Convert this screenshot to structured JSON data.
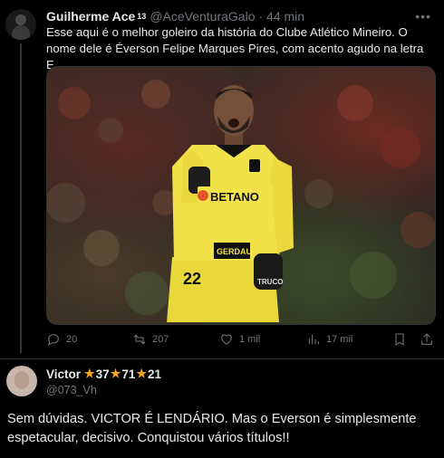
{
  "tweet1": {
    "author": "Guilherme Ace",
    "author_badge": "13",
    "handle": "@AceVenturaGalo",
    "time": "· 44 min",
    "text": "Esse aqui é o melhor goleiro da história do Clube Atlético Mineiro. O nome dele é Éverson Felipe Marques Pires, com acento agudo na letra E.",
    "media": {
      "sponsor_chest": "BETANO",
      "sponsor_belly": "GERDAU",
      "shorts_number": "22",
      "glove_text": "TRUCO"
    },
    "stats": {
      "replies": "20",
      "retweets": "207",
      "likes": "1 mil",
      "views": "17 mil"
    },
    "icons": [
      "reply-icon",
      "retweet-icon",
      "like-icon",
      "views-icon",
      "bookmark-icon",
      "share-icon",
      "more-icon"
    ]
  },
  "tweet2": {
    "author": "Victor",
    "badges": [
      "37",
      "71",
      "21"
    ],
    "handle": "@073_Vh",
    "text": "Sem dúvidas. VICTOR É LENDÁRIO. Mas o Everson é simplesmente espetacular, decisivo. Conquistou vários títulos!!"
  },
  "colors": {
    "background": "#000000",
    "text": "#e7e9ea",
    "muted": "#71767b",
    "divider": "#2f3336",
    "star": "#f5a623",
    "kit_yellow": "#f2e24a"
  }
}
